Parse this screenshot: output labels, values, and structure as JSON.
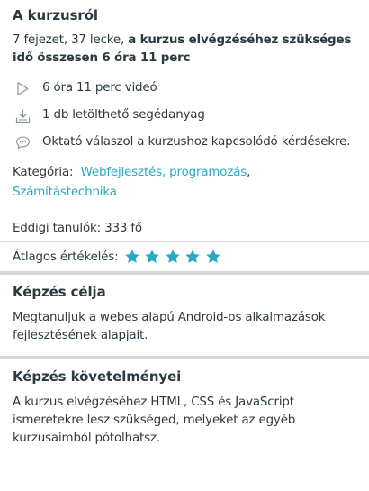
{
  "about": {
    "title": "A kurzusról",
    "summary_prefix": "7 fejezet, 37 lecke, ",
    "summary_bold": "a kurzus elvégzéséhez szükséges idő összesen 6 óra 11 perc",
    "features": [
      {
        "icon": "play-icon",
        "text": "6 óra 11 perc videó"
      },
      {
        "icon": "download-icon",
        "text": "1 db letölthető segédanyag"
      },
      {
        "icon": "chat-icon",
        "text": "Oktató válaszol a kurzushoz kapcsolódó kérdésekre."
      }
    ],
    "category_label": "Kategória:",
    "categories": [
      "Webfejlesztés, programozás",
      "Számítástechnika"
    ],
    "category_separator": ","
  },
  "stats": {
    "students": "Eddigi tanulók: 333 fő",
    "rating_label": "Átlagos értékelés:",
    "rating_value": 5,
    "rating_max": 5,
    "star_color": "#28a9c4"
  },
  "goal": {
    "title": "Képzés célja",
    "text": "Megtanuljuk a webes alapú Android-os alkalmazások fejlesztésének alapjait."
  },
  "requirements": {
    "title": "Képzés követelményei",
    "text": "A kurzus elvégzéséhez HTML, CSS és JavaScript ismeretekre lesz szükséged, melyeket az egyéb kurzusaimból pótolhatsz."
  },
  "colors": {
    "text": "#2c3a40",
    "link": "#28a9c4",
    "divider": "#d7d7d7",
    "icon": "#8a9499"
  }
}
